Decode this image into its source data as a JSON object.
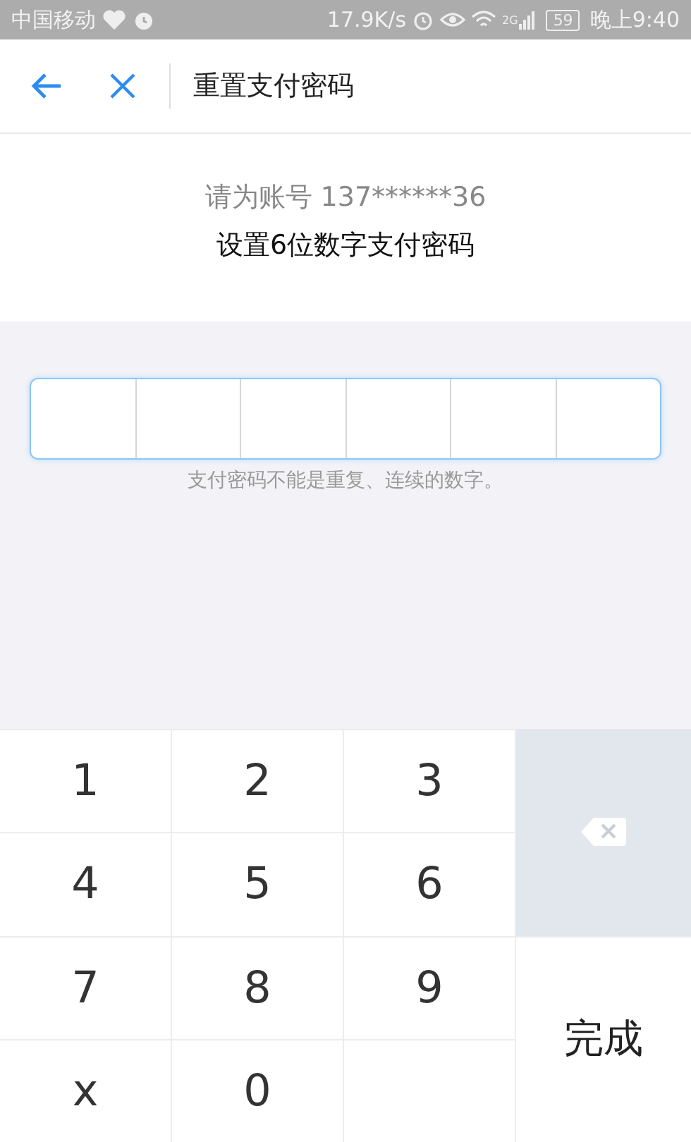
{
  "status_bar": {
    "carrier": "中国移动",
    "speed": "17.9K/s",
    "network": "2G",
    "battery": "59",
    "time": "晚上9:40"
  },
  "header": {
    "title": "重置支付密码"
  },
  "info": {
    "account_line": "请为账号 137******36",
    "instruction": "设置6位数字支付密码"
  },
  "password": {
    "cells": [
      {
        "filled": false
      },
      {
        "filled": false
      },
      {
        "filled": false
      },
      {
        "filled": false
      },
      {
        "filled": false
      },
      {
        "filled": false
      }
    ],
    "hint": "支付密码不能是重复、连续的数字。"
  },
  "keypad": [
    {
      "kind": "digit",
      "label": "1"
    },
    {
      "kind": "digit",
      "label": "2"
    },
    {
      "kind": "digit",
      "label": "3"
    },
    {
      "kind": "delete"
    },
    {
      "kind": "digit",
      "label": "4"
    },
    {
      "kind": "digit",
      "label": "5"
    },
    {
      "kind": "digit",
      "label": "6"
    },
    {
      "kind": "digit",
      "label": "7"
    },
    {
      "kind": "digit",
      "label": "8"
    },
    {
      "kind": "digit",
      "label": "9"
    },
    {
      "kind": "done",
      "label": "完成"
    },
    {
      "kind": "digit",
      "label": "x"
    },
    {
      "kind": "digit",
      "label": "0"
    },
    {
      "kind": "blank"
    }
  ]
}
